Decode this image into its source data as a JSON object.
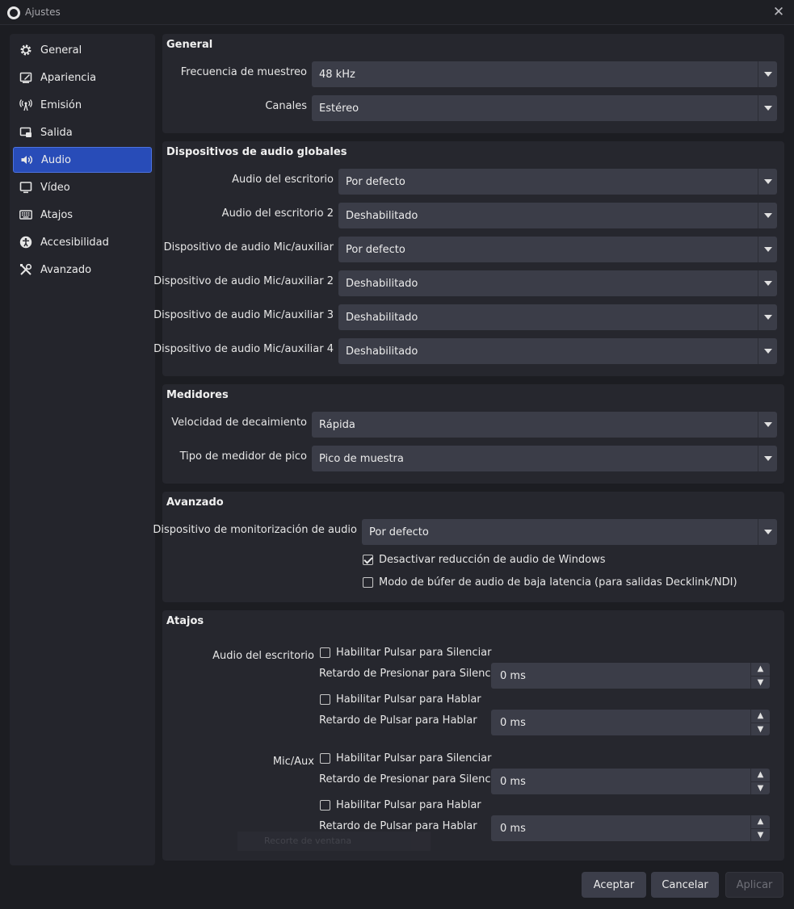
{
  "window": {
    "title": "Ajustes"
  },
  "sidebar": {
    "items": [
      {
        "label": "General",
        "icon": "gear-icon"
      },
      {
        "label": "Apariencia",
        "icon": "appearance-icon"
      },
      {
        "label": "Emisión",
        "icon": "broadcast-icon"
      },
      {
        "label": "Salida",
        "icon": "output-icon"
      },
      {
        "label": "Audio",
        "icon": "speaker-icon",
        "active": true
      },
      {
        "label": "Vídeo",
        "icon": "monitor-icon"
      },
      {
        "label": "Atajos",
        "icon": "keyboard-icon"
      },
      {
        "label": "Accesibilidad",
        "icon": "accessibility-icon"
      },
      {
        "label": "Avanzado",
        "icon": "tools-icon"
      }
    ]
  },
  "general": {
    "title": "General",
    "sample_rate_label": "Frecuencia de muestreo",
    "sample_rate_value": "48 kHz",
    "channels_label": "Canales",
    "channels_value": "Estéreo"
  },
  "global_devices": {
    "title": "Dispositivos de audio globales",
    "rows": [
      {
        "label": "Audio del escritorio",
        "value": "Por defecto"
      },
      {
        "label": "Audio del escritorio 2",
        "value": "Deshabilitado"
      },
      {
        "label": "Dispositivo de audio Mic/auxiliar",
        "value": "Por defecto"
      },
      {
        "label": "Dispositivo de audio Mic/auxiliar 2",
        "value": "Deshabilitado"
      },
      {
        "label": "Dispositivo de audio Mic/auxiliar 3",
        "value": "Deshabilitado"
      },
      {
        "label": "Dispositivo de audio Mic/auxiliar 4",
        "value": "Deshabilitado"
      }
    ]
  },
  "meters": {
    "title": "Medidores",
    "decay_label": "Velocidad de decaimiento",
    "decay_value": "Rápida",
    "peak_label": "Tipo de medidor de pico",
    "peak_value": "Pico de muestra"
  },
  "advanced": {
    "title": "Avanzado",
    "monitor_label": "Dispositivo de monitorización de audio",
    "monitor_value": "Por defecto",
    "ducking_label": "Desactivar reducción de audio de Windows",
    "ducking_checked": true,
    "low_latency_label": "Modo de búfer de audio de baja latencia (para salidas Decklink/NDI)",
    "low_latency_checked": false
  },
  "hotkeys": {
    "title": "Atajos",
    "sources": [
      {
        "name": "Audio del escritorio",
        "push_to_mute_label": "Habilitar Pulsar para Silenciar",
        "push_to_mute_delay_label": "Retardo de Presionar para Silenciar",
        "push_to_mute_delay": "0 ms",
        "push_to_talk_label": "Habilitar Pulsar para Hablar",
        "push_to_talk_delay_label": "Retardo de Pulsar para Hablar",
        "push_to_talk_delay": "0 ms"
      },
      {
        "name": "Mic/Aux",
        "push_to_mute_label": "Habilitar Pulsar para Silenciar",
        "push_to_mute_delay_label": "Retardo de Presionar para Silenciar",
        "push_to_mute_delay": "0 ms",
        "push_to_talk_label": "Habilitar Pulsar para Hablar",
        "push_to_talk_delay_label": "Retardo de Pulsar para Hablar",
        "push_to_talk_delay": "0 ms"
      }
    ]
  },
  "tooltip_ghost": "Recorte de ventana",
  "buttons": {
    "accept": "Aceptar",
    "cancel": "Cancelar",
    "apply": "Aplicar"
  },
  "colors": {
    "accent": "#284cb8",
    "background": "#1c1d22",
    "panel": "#26272e",
    "control": "#3b3d48"
  }
}
